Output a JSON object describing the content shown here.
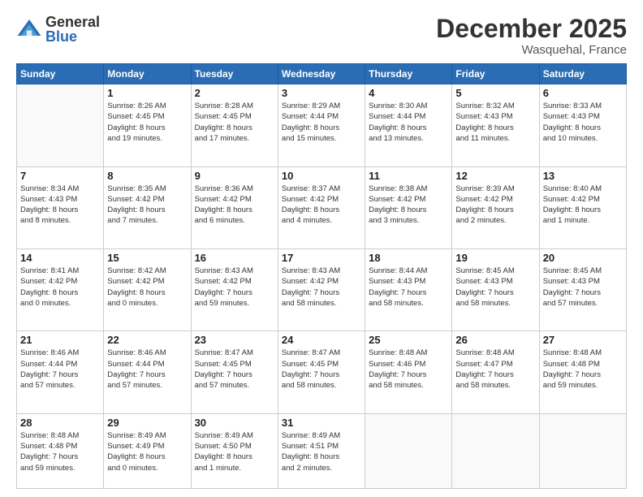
{
  "logo": {
    "general": "General",
    "blue": "Blue"
  },
  "header": {
    "month": "December 2025",
    "location": "Wasquehal, France"
  },
  "weekdays": [
    "Sunday",
    "Monday",
    "Tuesday",
    "Wednesday",
    "Thursday",
    "Friday",
    "Saturday"
  ],
  "rows": [
    [
      {
        "date": "",
        "info": ""
      },
      {
        "date": "1",
        "info": "Sunrise: 8:26 AM\nSunset: 4:45 PM\nDaylight: 8 hours\nand 19 minutes."
      },
      {
        "date": "2",
        "info": "Sunrise: 8:28 AM\nSunset: 4:45 PM\nDaylight: 8 hours\nand 17 minutes."
      },
      {
        "date": "3",
        "info": "Sunrise: 8:29 AM\nSunset: 4:44 PM\nDaylight: 8 hours\nand 15 minutes."
      },
      {
        "date": "4",
        "info": "Sunrise: 8:30 AM\nSunset: 4:44 PM\nDaylight: 8 hours\nand 13 minutes."
      },
      {
        "date": "5",
        "info": "Sunrise: 8:32 AM\nSunset: 4:43 PM\nDaylight: 8 hours\nand 11 minutes."
      },
      {
        "date": "6",
        "info": "Sunrise: 8:33 AM\nSunset: 4:43 PM\nDaylight: 8 hours\nand 10 minutes."
      }
    ],
    [
      {
        "date": "7",
        "info": "Sunrise: 8:34 AM\nSunset: 4:43 PM\nDaylight: 8 hours\nand 8 minutes."
      },
      {
        "date": "8",
        "info": "Sunrise: 8:35 AM\nSunset: 4:42 PM\nDaylight: 8 hours\nand 7 minutes."
      },
      {
        "date": "9",
        "info": "Sunrise: 8:36 AM\nSunset: 4:42 PM\nDaylight: 8 hours\nand 6 minutes."
      },
      {
        "date": "10",
        "info": "Sunrise: 8:37 AM\nSunset: 4:42 PM\nDaylight: 8 hours\nand 4 minutes."
      },
      {
        "date": "11",
        "info": "Sunrise: 8:38 AM\nSunset: 4:42 PM\nDaylight: 8 hours\nand 3 minutes."
      },
      {
        "date": "12",
        "info": "Sunrise: 8:39 AM\nSunset: 4:42 PM\nDaylight: 8 hours\nand 2 minutes."
      },
      {
        "date": "13",
        "info": "Sunrise: 8:40 AM\nSunset: 4:42 PM\nDaylight: 8 hours\nand 1 minute."
      }
    ],
    [
      {
        "date": "14",
        "info": "Sunrise: 8:41 AM\nSunset: 4:42 PM\nDaylight: 8 hours\nand 0 minutes."
      },
      {
        "date": "15",
        "info": "Sunrise: 8:42 AM\nSunset: 4:42 PM\nDaylight: 8 hours\nand 0 minutes."
      },
      {
        "date": "16",
        "info": "Sunrise: 8:43 AM\nSunset: 4:42 PM\nDaylight: 7 hours\nand 59 minutes."
      },
      {
        "date": "17",
        "info": "Sunrise: 8:43 AM\nSunset: 4:42 PM\nDaylight: 7 hours\nand 58 minutes."
      },
      {
        "date": "18",
        "info": "Sunrise: 8:44 AM\nSunset: 4:43 PM\nDaylight: 7 hours\nand 58 minutes."
      },
      {
        "date": "19",
        "info": "Sunrise: 8:45 AM\nSunset: 4:43 PM\nDaylight: 7 hours\nand 58 minutes."
      },
      {
        "date": "20",
        "info": "Sunrise: 8:45 AM\nSunset: 4:43 PM\nDaylight: 7 hours\nand 57 minutes."
      }
    ],
    [
      {
        "date": "21",
        "info": "Sunrise: 8:46 AM\nSunset: 4:44 PM\nDaylight: 7 hours\nand 57 minutes."
      },
      {
        "date": "22",
        "info": "Sunrise: 8:46 AM\nSunset: 4:44 PM\nDaylight: 7 hours\nand 57 minutes."
      },
      {
        "date": "23",
        "info": "Sunrise: 8:47 AM\nSunset: 4:45 PM\nDaylight: 7 hours\nand 57 minutes."
      },
      {
        "date": "24",
        "info": "Sunrise: 8:47 AM\nSunset: 4:45 PM\nDaylight: 7 hours\nand 58 minutes."
      },
      {
        "date": "25",
        "info": "Sunrise: 8:48 AM\nSunset: 4:46 PM\nDaylight: 7 hours\nand 58 minutes."
      },
      {
        "date": "26",
        "info": "Sunrise: 8:48 AM\nSunset: 4:47 PM\nDaylight: 7 hours\nand 58 minutes."
      },
      {
        "date": "27",
        "info": "Sunrise: 8:48 AM\nSunset: 4:48 PM\nDaylight: 7 hours\nand 59 minutes."
      }
    ],
    [
      {
        "date": "28",
        "info": "Sunrise: 8:48 AM\nSunset: 4:48 PM\nDaylight: 7 hours\nand 59 minutes."
      },
      {
        "date": "29",
        "info": "Sunrise: 8:49 AM\nSunset: 4:49 PM\nDaylight: 8 hours\nand 0 minutes."
      },
      {
        "date": "30",
        "info": "Sunrise: 8:49 AM\nSunset: 4:50 PM\nDaylight: 8 hours\nand 1 minute."
      },
      {
        "date": "31",
        "info": "Sunrise: 8:49 AM\nSunset: 4:51 PM\nDaylight: 8 hours\nand 2 minutes."
      },
      {
        "date": "",
        "info": ""
      },
      {
        "date": "",
        "info": ""
      },
      {
        "date": "",
        "info": ""
      }
    ]
  ]
}
